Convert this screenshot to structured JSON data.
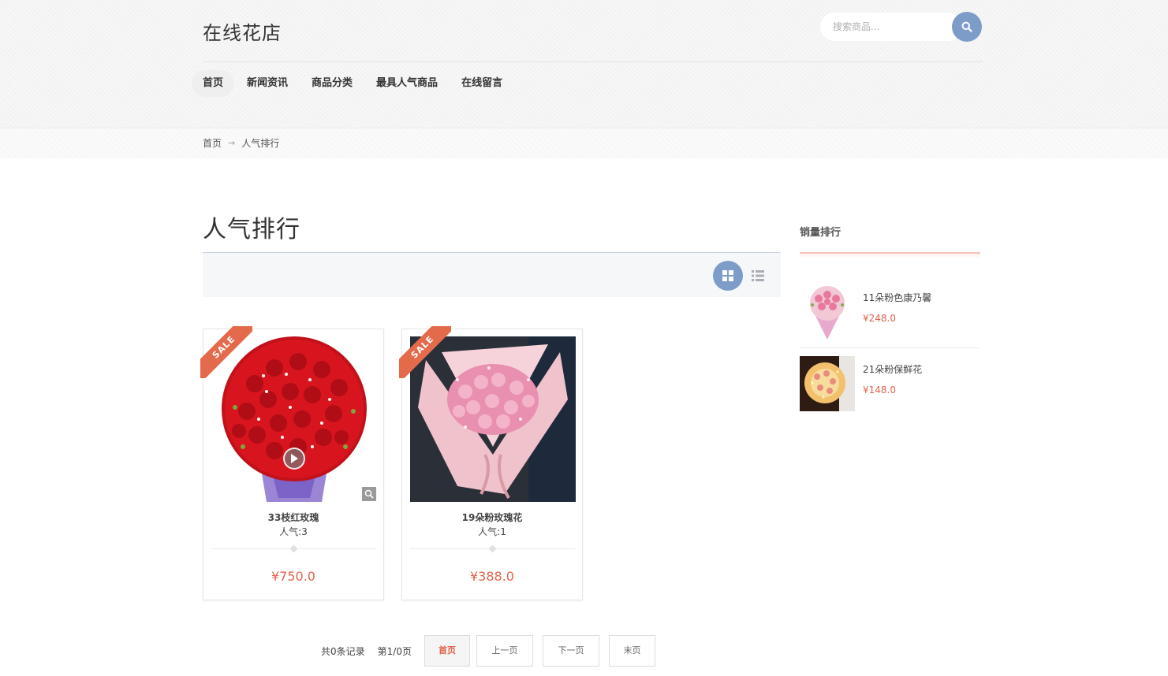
{
  "header": {
    "logo": "在线花店",
    "search_placeholder": "搜索商品..."
  },
  "nav": {
    "items": [
      "首页",
      "新闻资讯",
      "商品分类",
      "最具人气商品",
      "在线留言"
    ],
    "active_index": 0
  },
  "breadcrumb": {
    "home": "首页",
    "current": "人气排行"
  },
  "main": {
    "title": "人气排行",
    "products": [
      {
        "name": "33枝红玫瑰",
        "popularity": "人气:3",
        "price": "¥750.0",
        "badge": "SALE"
      },
      {
        "name": "19朵粉玫瑰花",
        "popularity": "人气:1",
        "price": "¥388.0",
        "badge": "SALE"
      }
    ]
  },
  "sidebar": {
    "title": "销量排行",
    "items": [
      {
        "name": "11朵粉色康乃馨",
        "price": "¥248.0"
      },
      {
        "name": "21朵粉保鲜花",
        "price": "¥148.0"
      }
    ]
  },
  "pagination": {
    "total": "共0条记录",
    "page": "第1/0页",
    "first": "首页",
    "prev": "上一页",
    "next": "下一页",
    "last": "末页"
  },
  "colors": {
    "accent_blue": "#7e9cc8",
    "price_red": "#e0644c",
    "sale_ribbon": "#e46a4c"
  }
}
